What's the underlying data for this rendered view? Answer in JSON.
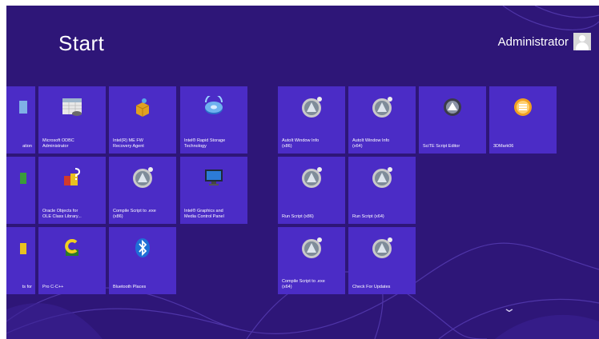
{
  "header": {
    "title": "Start",
    "user_name": "Administrator"
  },
  "tiles": {
    "t_odbc_partial": {
      "label": "ation"
    },
    "t_odbc": {
      "label": "Microsoft ODBC\nAdministrator"
    },
    "t_me_fw": {
      "label": "Intel(R) ME FW\nRecovery Agent"
    },
    "t_rst": {
      "label": "Intel® Rapid Storage\nTechnology"
    },
    "t_autoit_x86": {
      "label": "AutoIt Window Info\n(x86)"
    },
    "t_autoit_x64": {
      "label": "AutoIt Window Info\n(x64)"
    },
    "t_scite": {
      "label": "SciTE Script Editor"
    },
    "t_3dmark": {
      "label": "3DMark06"
    },
    "t_row2_partial": {
      "label": ""
    },
    "t_oracle": {
      "label": "Oracle Objects for\nOLE Class Library..."
    },
    "t_compile_x86": {
      "label": "Compile Script to .exe\n(x86)"
    },
    "t_graphics": {
      "label": "Intel® Graphics and\nMedia Control Panel"
    },
    "t_run_x86": {
      "label": "Run Script (x86)"
    },
    "t_run_x64": {
      "label": "Run Script (x64)"
    },
    "t_row3_partial": {
      "label": "ts for"
    },
    "t_proc": {
      "label": "Pro C-C++"
    },
    "t_bluetooth": {
      "label": "Bluetooth Places"
    },
    "t_compile_x64": {
      "label": "Compile Script to .exe\n(x64)"
    },
    "t_updates": {
      "label": "Check For Updates"
    }
  },
  "colors": {
    "background": "#2e1678",
    "tile": "#4b2cc6"
  },
  "icons": [
    "user-avatar-icon",
    "odbc-icon",
    "package-icon",
    "storage-icon",
    "autoit-icon",
    "scite-icon",
    "3dmark-icon",
    "oracle-icon",
    "graphics-monitor-icon",
    "proc-icon",
    "bluetooth-icon",
    "chevron-down-icon"
  ]
}
